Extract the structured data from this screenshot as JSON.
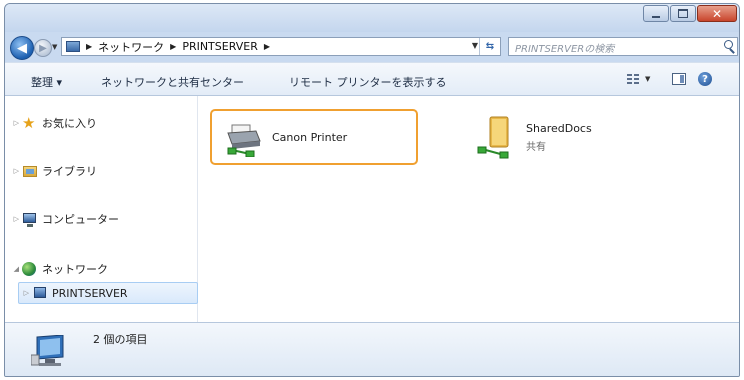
{
  "titlebar": {
    "buttons": [
      "minimize-icon",
      "maximize-icon",
      "close-icon"
    ]
  },
  "nav": {
    "back_icon": "back-arrow-icon",
    "forward_icon": "forward-arrow-icon",
    "breadcrumb": [
      "ネットワーク",
      "PRINTSERVER"
    ],
    "search_placeholder": "PRINTSERVERの検索"
  },
  "toolbar": {
    "organize": "整理 ▾",
    "network_center": "ネットワークと共有センター",
    "show_printers": "リモート プリンターを表示する"
  },
  "sidebar": {
    "items": [
      {
        "label": "お気に入り",
        "icon": "star-icon"
      },
      {
        "label": "ライブラリ",
        "icon": "library-icon"
      },
      {
        "label": "コンピューター",
        "icon": "computer-icon"
      },
      {
        "label": "ネットワーク",
        "icon": "network-icon"
      },
      {
        "label": "PRINTSERVER",
        "icon": "server-icon"
      }
    ]
  },
  "main": {
    "items": [
      {
        "label": "Canon Printer",
        "sub": "",
        "icon": "network-printer-icon"
      },
      {
        "label": "SharedDocs",
        "sub": "共有",
        "icon": "shared-folder-icon"
      }
    ]
  },
  "status": {
    "text": "2 個の項目"
  },
  "colors": {
    "focus_border": "#f0a030",
    "selection_bg": "#d9e9fb",
    "chrome": "#c9daf0"
  }
}
